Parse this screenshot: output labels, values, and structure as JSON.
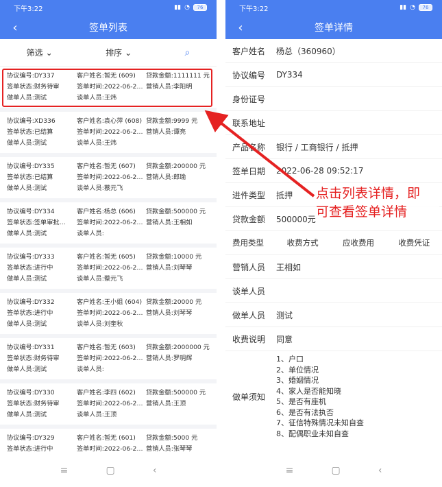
{
  "status": {
    "time": "下午3:22",
    "battery": "76"
  },
  "left": {
    "title": "签单列表",
    "filter_label": "筛选",
    "sort_label": "排序",
    "cards": [
      {
        "agreement": "协议编号:DY337",
        "customer": "客户姓名:暂无 (609)",
        "amount": "贷款金额:1111111 元",
        "status": "签单状态:财务待审",
        "time": "签单时间:2022-06-2…",
        "sales": "营销人员:李阳明",
        "maker": "做单人员:测试",
        "talker": "谈单人员:王炜"
      },
      {
        "agreement": "协议编号:XD336",
        "customer": "客户姓名:袁心萍 (608)",
        "amount": "贷款金额:9999 元",
        "status": "签单状态:已结算",
        "time": "签单时间:2022-06-2…",
        "sales": "营销人员:谭亮",
        "maker": "做单人员:测试",
        "talker": "谈单人员:王炜"
      },
      {
        "agreement": "协议编号:DY335",
        "customer": "客户姓名:暂无 (607)",
        "amount": "贷款金额:200000 元",
        "status": "签单状态:已结算",
        "time": "签单时间:2022-06-2…",
        "sales": "营销人员:郎瑜",
        "maker": "做单人员:测试",
        "talker": "谈单人员:蔡元飞"
      },
      {
        "agreement": "协议编号:DY334",
        "customer": "客户姓名:杨总 (606)",
        "amount": "贷款金额:500000 元",
        "status": "签单状态:签单审批…",
        "time": "签单时间:2022-06-2…",
        "sales": "营销人员:王相如",
        "maker": "做单人员:测试",
        "talker": "谈单人员:"
      },
      {
        "agreement": "协议编号:DY333",
        "customer": "客户姓名:暂无 (605)",
        "amount": "贷款金额:10000 元",
        "status": "签单状态:进行中",
        "time": "签单时间:2022-06-2…",
        "sales": "营销人员:刘琴琴",
        "maker": "做单人员:测试",
        "talker": "谈单人员:蔡元飞"
      },
      {
        "agreement": "协议编号:DY332",
        "customer": "客户姓名:王小姐 (604)",
        "amount": "贷款金额:20000 元",
        "status": "签单状态:进行中",
        "time": "签单时间:2022-06-2…",
        "sales": "营销人员:刘琴琴",
        "maker": "做单人员:测试",
        "talker": "谈单人员:刘奎秋"
      },
      {
        "agreement": "协议编号:DY331",
        "customer": "客户姓名:暂无 (603)",
        "amount": "贷款金额:2000000 元",
        "status": "签单状态:财务待审",
        "time": "签单时间:2022-06-2…",
        "sales": "营销人员:罗明辉",
        "maker": "做单人员:测试",
        "talker": "谈单人员:"
      },
      {
        "agreement": "协议编号:DY330",
        "customer": "客户姓名:李四 (602)",
        "amount": "贷款金额:500000 元",
        "status": "签单状态:财务待审",
        "time": "签单时间:2022-06-2…",
        "sales": "营销人员:王顶",
        "maker": "做单人员:测试",
        "talker": "谈单人员:王顶"
      },
      {
        "agreement": "协议编号:DY329",
        "customer": "客户姓名:暂无 (601)",
        "amount": "贷款金额:5000 元",
        "status": "签单状态:进行中",
        "time": "签单时间:2022-06-2…",
        "sales": "营销人员:张琴琴",
        "maker": "",
        "talker": ""
      }
    ]
  },
  "right": {
    "title": "签单详情",
    "fields": [
      {
        "label": "客户姓名",
        "value": "杨总（360960）"
      },
      {
        "label": "协议编号",
        "value": "DY334"
      },
      {
        "label": "身份证号",
        "value": ""
      },
      {
        "label": "联系地址",
        "value": ""
      },
      {
        "label": "产品名称",
        "value": "银行 / 工商银行 / 抵押"
      },
      {
        "label": "签单日期",
        "value": "2022-06-28 09:52:17"
      },
      {
        "label": "进件类型",
        "value": "抵押"
      },
      {
        "label": "贷款金额",
        "value": "500000元"
      }
    ],
    "fee_header": [
      "费用类型",
      "收费方式",
      "应收费用",
      "收费凭证"
    ],
    "fields2": [
      {
        "label": "营销人员",
        "value": "王相如"
      },
      {
        "label": "谈单人员",
        "value": ""
      },
      {
        "label": "做单人员",
        "value": "测试"
      },
      {
        "label": "收费说明",
        "value": "同意"
      }
    ],
    "notes_label": "做单须知",
    "notes": [
      "1、户口",
      "2、单位情况",
      "3、婚姻情况",
      "4、家人是否能知晓",
      "5、是否有座机",
      "6、是否有法执否",
      "7、征信特殊情况未知自查",
      "8、配偶职业未知自查"
    ]
  },
  "annotation": {
    "line1": "点击列表详情，即",
    "line2": "可查看签单详情"
  },
  "colors": {
    "primary": "#4a7ff0",
    "highlight": "#e52222"
  }
}
